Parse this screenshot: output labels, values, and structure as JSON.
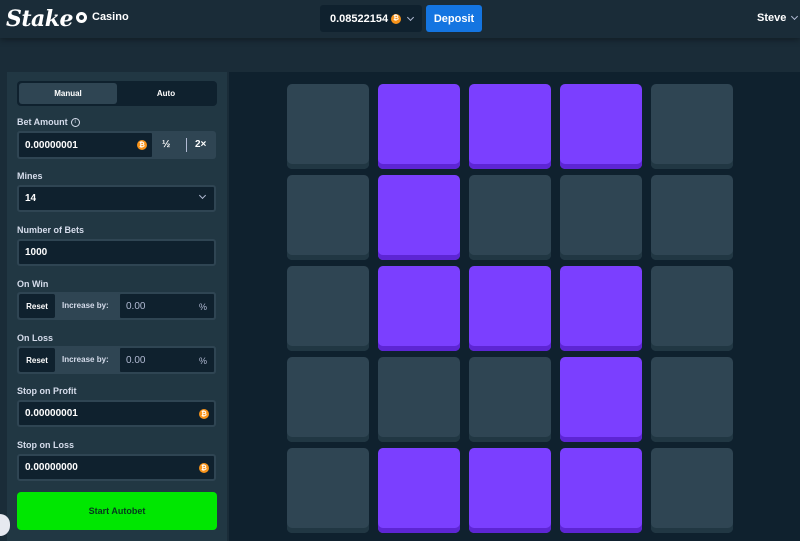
{
  "header": {
    "logo": "Stake",
    "nav_casino": "Casino",
    "balance": "0.08522154",
    "coin_symbol": "₿",
    "deposit_label": "Deposit",
    "username": "Steve"
  },
  "sidebar": {
    "tabs": [
      {
        "label": "Manual",
        "active": true
      },
      {
        "label": "Auto",
        "active": false
      }
    ],
    "bet_amount": {
      "label": "Bet Amount",
      "value": "0.00000001",
      "half_label": "½",
      "double_label": "2×"
    },
    "mines": {
      "label": "Mines",
      "value": "14"
    },
    "num_bets": {
      "label": "Number of Bets",
      "value": "1000"
    },
    "on_win": {
      "label": "On Win",
      "reset_label": "Reset",
      "increase_label": "Increase by:",
      "value": "0.00",
      "unit": "%"
    },
    "on_loss": {
      "label": "On Loss",
      "reset_label": "Reset",
      "increase_label": "Increase by:",
      "value": "0.00",
      "unit": "%"
    },
    "stop_profit": {
      "label": "Stop on Profit",
      "value": "0.00000001"
    },
    "stop_loss": {
      "label": "Stop on Loss",
      "value": "0.00000000"
    },
    "start_label": "Start Autobet"
  },
  "grid": {
    "columns": 5,
    "rows": [
      [
        "hidden",
        "gem",
        "gem",
        "gem",
        "hidden"
      ],
      [
        "hidden",
        "gem",
        "hidden",
        "hidden",
        "hidden"
      ],
      [
        "hidden",
        "gem",
        "gem",
        "gem",
        "hidden"
      ],
      [
        "hidden",
        "hidden",
        "hidden",
        "gem",
        "hidden"
      ],
      [
        "hidden",
        "gem",
        "gem",
        "gem",
        "hidden"
      ]
    ]
  },
  "colors": {
    "gem_tile": "#7b3fff",
    "hidden_tile": "#2f4553",
    "start_button": "#00e701",
    "deposit_button": "#1475e1",
    "coin": "#f7931a"
  }
}
